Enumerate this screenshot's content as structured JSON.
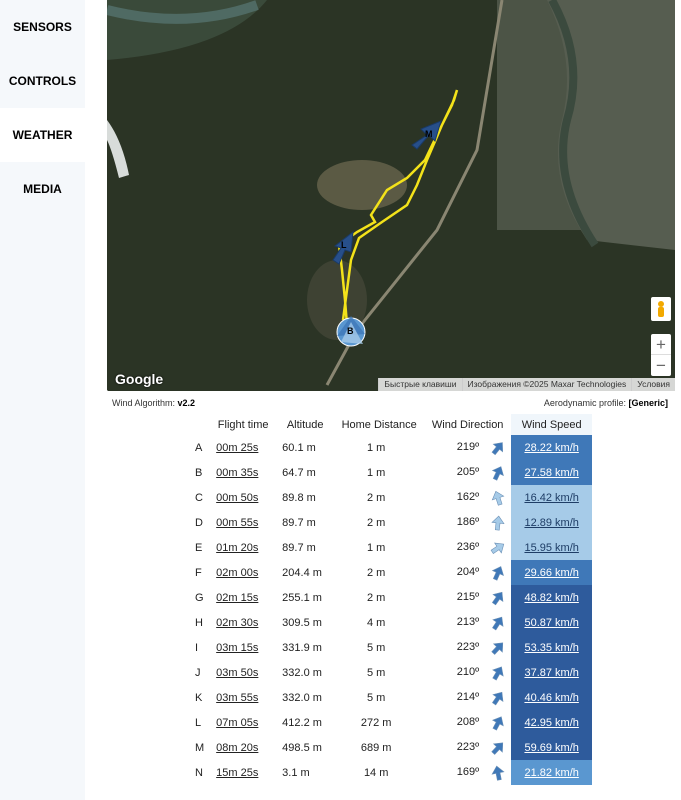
{
  "sidebar": {
    "items": [
      {
        "label": "SENSORS",
        "active": false
      },
      {
        "label": "CONTROLS",
        "active": false
      },
      {
        "label": "WEATHER",
        "active": true
      },
      {
        "label": "MEDIA",
        "active": false
      }
    ]
  },
  "map": {
    "provider": "Google",
    "attribution": [
      "Быстрые клавиши",
      "Изображения ©2025 Maxar Technologies",
      "Условия"
    ],
    "zoom_in": "+",
    "zoom_out": "−",
    "markers": [
      "B",
      "L",
      "M"
    ]
  },
  "info": {
    "algorithm_label": "Wind Algorithm:",
    "algorithm_value": "v2.2",
    "profile_label": "Aerodynamic profile:",
    "profile_value": "[Generic]"
  },
  "table": {
    "headers": [
      "Flight time",
      "Altitude",
      "Home Distance",
      "Wind Direction",
      "Wind Speed"
    ],
    "rows": [
      {
        "label": "A",
        "flight_time": "00m 25s",
        "altitude": "60.1 m",
        "home_distance": "1 m",
        "wind_direction": "219º",
        "wind_speed": "28.22 km/h",
        "color": "#3f78b8"
      },
      {
        "label": "B",
        "flight_time": "00m 35s",
        "altitude": "64.7 m",
        "home_distance": "1 m",
        "wind_direction": "205º",
        "wind_speed": "27.58 km/h",
        "color": "#3f78b8"
      },
      {
        "label": "C",
        "flight_time": "00m 50s",
        "altitude": "89.8 m",
        "home_distance": "2 m",
        "wind_direction": "162º",
        "wind_speed": "16.42 km/h",
        "color": "#a6cbe8"
      },
      {
        "label": "D",
        "flight_time": "00m 55s",
        "altitude": "89.7 m",
        "home_distance": "2 m",
        "wind_direction": "186º",
        "wind_speed": "12.89 km/h",
        "color": "#a6cbe8"
      },
      {
        "label": "E",
        "flight_time": "01m 20s",
        "altitude": "89.7 m",
        "home_distance": "1 m",
        "wind_direction": "236º",
        "wind_speed": "15.95 km/h",
        "color": "#a6cbe8"
      },
      {
        "label": "F",
        "flight_time": "02m 00s",
        "altitude": "204.4 m",
        "home_distance": "2 m",
        "wind_direction": "204º",
        "wind_speed": "29.66 km/h",
        "color": "#3f78b8"
      },
      {
        "label": "G",
        "flight_time": "02m 15s",
        "altitude": "255.1 m",
        "home_distance": "2 m",
        "wind_direction": "215º",
        "wind_speed": "48.82 km/h",
        "color": "#2e5b9c"
      },
      {
        "label": "H",
        "flight_time": "02m 30s",
        "altitude": "309.5 m",
        "home_distance": "4 m",
        "wind_direction": "213º",
        "wind_speed": "50.87 km/h",
        "color": "#2e5b9c"
      },
      {
        "label": "I",
        "flight_time": "03m 15s",
        "altitude": "331.9 m",
        "home_distance": "5 m",
        "wind_direction": "223º",
        "wind_speed": "53.35 km/h",
        "color": "#2e5b9c"
      },
      {
        "label": "J",
        "flight_time": "03m 50s",
        "altitude": "332.0 m",
        "home_distance": "5 m",
        "wind_direction": "210º",
        "wind_speed": "37.87 km/h",
        "color": "#2e5b9c"
      },
      {
        "label": "K",
        "flight_time": "03m 55s",
        "altitude": "332.0 m",
        "home_distance": "5 m",
        "wind_direction": "214º",
        "wind_speed": "40.46 km/h",
        "color": "#2e5b9c"
      },
      {
        "label": "L",
        "flight_time": "07m 05s",
        "altitude": "412.2 m",
        "home_distance": "272 m",
        "wind_direction": "208º",
        "wind_speed": "42.95 km/h",
        "color": "#2e5b9c"
      },
      {
        "label": "M",
        "flight_time": "08m 20s",
        "altitude": "498.5 m",
        "home_distance": "689 m",
        "wind_direction": "223º",
        "wind_speed": "59.69 km/h",
        "color": "#2e5b9c"
      },
      {
        "label": "N",
        "flight_time": "15m 25s",
        "altitude": "3.1 m",
        "home_distance": "14 m",
        "wind_direction": "169º",
        "wind_speed": "21.82 km/h",
        "color": "#5a97d0"
      }
    ]
  }
}
